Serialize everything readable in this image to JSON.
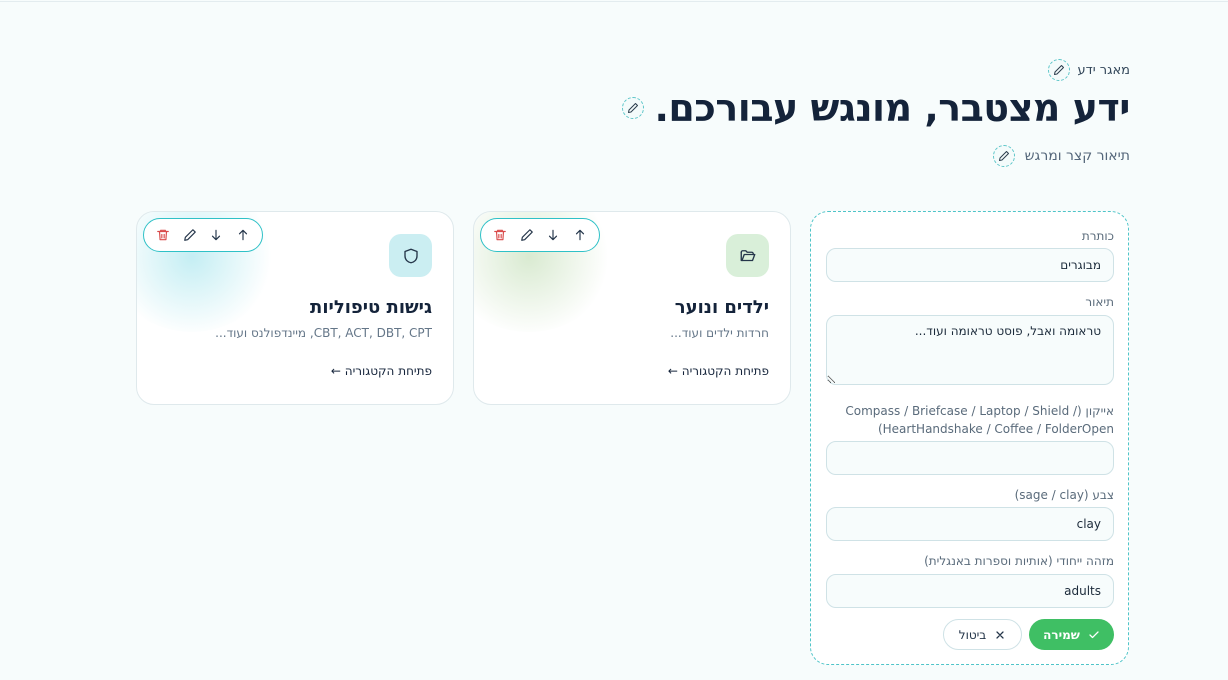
{
  "header": {
    "eyebrow": "מאגר ידע",
    "title": "ידע מצטבר, מונגש עבורכם.",
    "subtitle": "תיאור קצר ומרגש"
  },
  "cards": [
    {
      "title": "ילדים ונוער",
      "description": "חרדות ילדים ועוד...",
      "link": "פתיחת הקטגוריה ←",
      "icon": "folder-open-icon",
      "color": "sage"
    },
    {
      "title": "גישות טיפוליות",
      "description": "CBT, ACT, DBT, CPT, מיינדפולנס ועוד...",
      "link": "פתיחת הקטגוריה ←",
      "icon": "shield-icon",
      "color": "teal"
    }
  ],
  "form": {
    "title_label": "כותרת",
    "title_value": "מבוגרים",
    "description_label": "תיאור",
    "description_value": "טראומה ואבל, פוסט טראומה ועוד...",
    "icon_label_line1": "אייקון (/ Compass / Briefcase / Laptop / Shield",
    "icon_label_line2": "HeartHandshake / Coffee / FolderOpen)",
    "icon_value": "",
    "color_label": "צבע (sage / clay)",
    "color_value": "clay",
    "slug_label": "מזהה ייחודי (אותיות וספרות באנגלית)",
    "slug_value": "adults",
    "save_label": "שמירה",
    "cancel_label": "ביטול"
  },
  "colors": {
    "accent": "#2fc1c7",
    "save": "#3fbf64",
    "delete": "#d94b4b",
    "sage": "#d9efd9",
    "teal": "#cbeef2"
  }
}
